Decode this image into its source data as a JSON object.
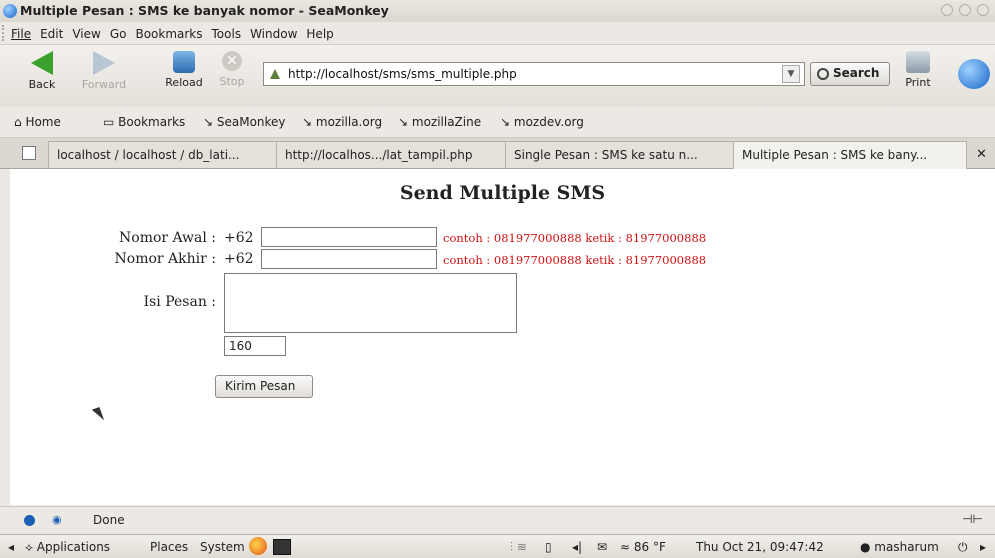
{
  "window": {
    "title": "Multiple Pesan : SMS ke banyak nomor - SeaMonkey"
  },
  "menu": [
    "File",
    "Edit",
    "View",
    "Go",
    "Bookmarks",
    "Tools",
    "Window",
    "Help"
  ],
  "nav": {
    "back": "Back",
    "forward": "Forward",
    "reload": "Reload",
    "stop": "Stop",
    "url": "http://localhost/sms/sms_multiple.php",
    "search": "Search",
    "print": "Print"
  },
  "bookmarks": [
    "Home",
    "Bookmarks",
    "SeaMonkey",
    "mozilla.org",
    "mozillaZine",
    "mozdev.org"
  ],
  "tabs": [
    "localhost / localhost / db_lati...",
    "http://localhos.../lat_tampil.php",
    "Single Pesan : SMS ke satu n...",
    "Multiple Pesan : SMS ke bany..."
  ],
  "form": {
    "heading": "Send Multiple SMS",
    "nomor_awal_label": "Nomor Awal :",
    "nomor_akhir_label": "Nomor Akhir :",
    "prefix": "+62",
    "hint": "contoh : 081977000888 ketik : 81977000888",
    "isi_pesan_label": "Isi Pesan :",
    "counter": "160",
    "submit": "Kirim Pesan"
  },
  "status": {
    "text": "Done"
  },
  "panel": {
    "applications": "Applications",
    "places": "Places",
    "system": "System",
    "weather": "86 °F",
    "clock": "Thu Oct 21, 09:47:42",
    "user": "masharum"
  }
}
